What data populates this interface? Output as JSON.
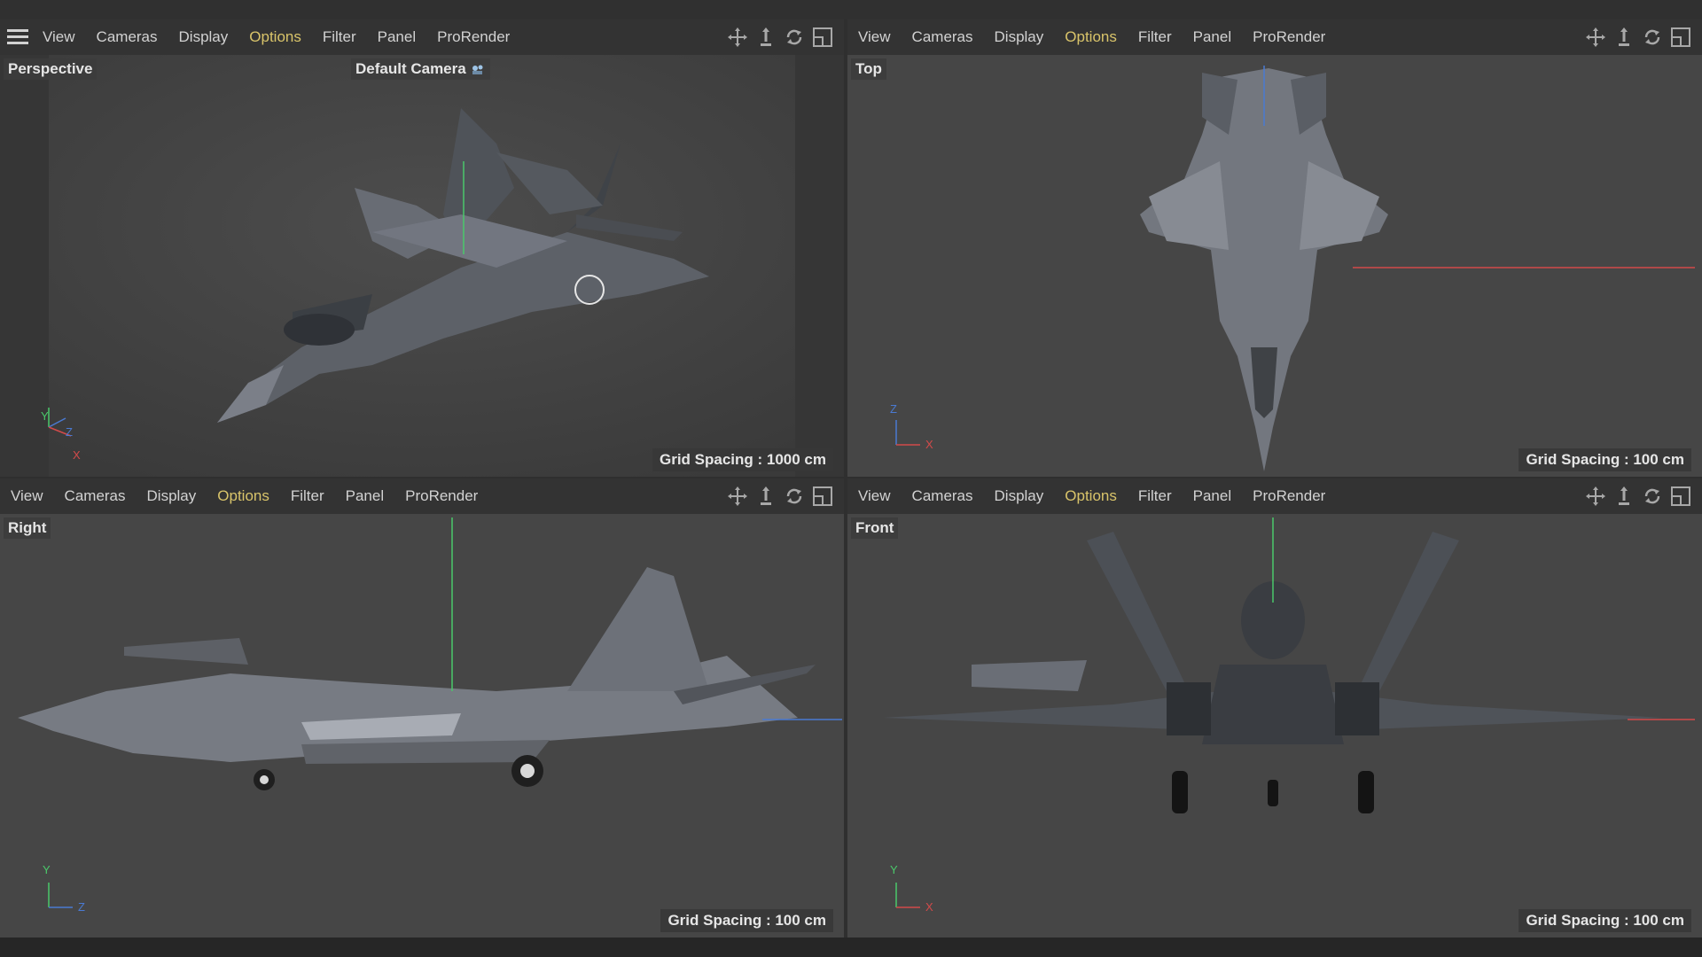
{
  "menu": [
    "View",
    "Cameras",
    "Display",
    "Options",
    "Filter",
    "Panel",
    "ProRender"
  ],
  "viewports": {
    "perspective": {
      "label": "Perspective",
      "camera": "Default Camera",
      "grid": "Grid Spacing : 1000 cm",
      "axes": [
        "Y",
        "Z",
        "X"
      ]
    },
    "top": {
      "label": "Top",
      "grid": "Grid Spacing : 100 cm",
      "axes": [
        "Z",
        "X"
      ]
    },
    "right": {
      "label": "Right",
      "grid": "Grid Spacing : 100 cm",
      "axes": [
        "Y",
        "Z"
      ]
    },
    "front": {
      "label": "Front",
      "grid": "Grid Spacing : 100 cm",
      "axes": [
        "Y",
        "X"
      ]
    }
  },
  "icons": [
    "menu-icon",
    "move-view-icon",
    "zoom-view-icon",
    "rotate-view-icon",
    "toggle-layout-icon",
    "camera-icon"
  ],
  "colors": {
    "menubar": "#333333",
    "viewport": "#454545",
    "options_highlight": "#d9c46a",
    "axis_x": "#d24a4a",
    "axis_y": "#4ac86a",
    "axis_z": "#4a7ad2"
  }
}
